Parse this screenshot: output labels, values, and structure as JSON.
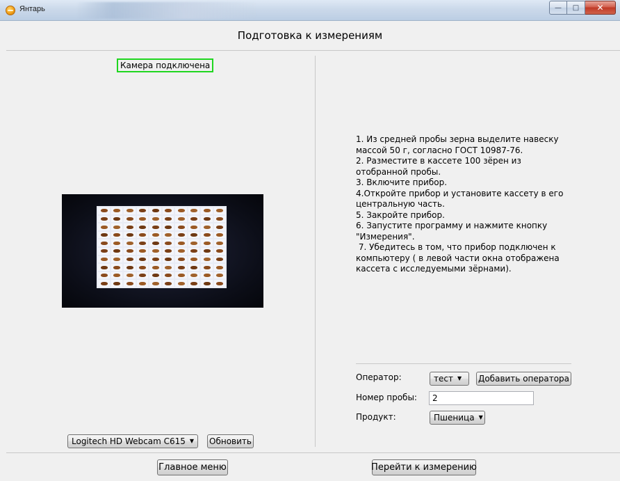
{
  "window": {
    "title": "Янтарь",
    "controls": {
      "minimize": "—",
      "maximize": "□",
      "close": "✕"
    }
  },
  "page_title": "Подготовка к измерениям",
  "camera": {
    "status": "Камера подключена",
    "status_color": "#1fd61f",
    "device_selected": "Logitech HD Webcam C615",
    "refresh_label": "Обновить"
  },
  "instructions": [
    "1. Из средней пробы зерна выделите навеску",
    "массой 50 г, согласно ГОСТ 10987-76.",
    "2. Разместите в кассете 100 зёрен из",
    "отобранной пробы.",
    "3. Включите прибор.",
    "4.Откройте прибор и установите кассету в его",
    "центральную часть.",
    "5. Закройте прибор.",
    "6. Запустите программу и нажмите кнопку",
    "\"Измерения\".",
    " 7. Убедитесь в том, что прибор подключен к",
    "компьютеру ( в левой части окна отображена",
    "кассета с исследуемыми зёрнами)."
  ],
  "form": {
    "operator_label": "Оператор:",
    "operator_selected": "тест",
    "add_operator_label": "Добавить оператора",
    "sample_number_label": "Номер пробы:",
    "sample_number_value": "2",
    "product_label": "Продукт:",
    "product_selected": "Пшеница"
  },
  "footer": {
    "main_menu_label": "Главное меню",
    "go_to_measurement_label": "Перейти к измерению"
  },
  "icons": {
    "dropdown": "▼"
  }
}
